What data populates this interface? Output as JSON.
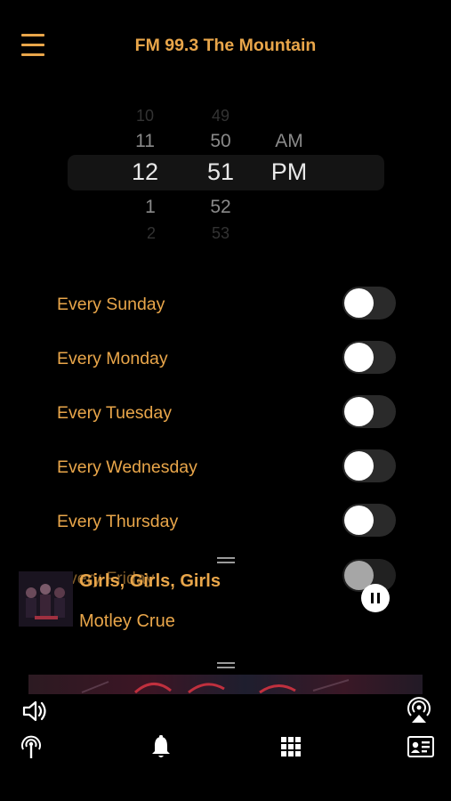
{
  "header": {
    "menu_icon": "hamburger-menu-icon",
    "title": "FM 99.3 The Mountain"
  },
  "time_picker": {
    "hours": [
      "10",
      "11",
      "12",
      "1",
      "2"
    ],
    "minutes": [
      "49",
      "50",
      "51",
      "52",
      "53"
    ],
    "periods": [
      "AM",
      "PM"
    ],
    "selected": {
      "hour": "12",
      "minute": "51",
      "period": "PM"
    }
  },
  "days": [
    {
      "label": "Every Sunday",
      "on": false
    },
    {
      "label": "Every Monday",
      "on": false
    },
    {
      "label": "Every Tuesday",
      "on": false
    },
    {
      "label": "Every Wednesday",
      "on": false
    },
    {
      "label": "Every Thursday",
      "on": false
    },
    {
      "label": "Every Friday",
      "on": false
    }
  ],
  "now_playing": {
    "song": "Girls, Girls, Girls",
    "artist": "Motley Crue",
    "state": "playing",
    "pause_icon": "pause-icon"
  },
  "toolbar": {
    "volume_icon": "volume-icon",
    "airplay_icon": "airplay-icon"
  },
  "tabs": [
    {
      "name": "radio",
      "icon": "broadcast-icon"
    },
    {
      "name": "alarm",
      "icon": "bell-icon"
    },
    {
      "name": "grid",
      "icon": "grid-icon"
    },
    {
      "name": "contact",
      "icon": "contact-card-icon"
    }
  ],
  "colors": {
    "accent": "#e9a64a",
    "background": "#000000",
    "toggle_off": "#2a2a2a"
  }
}
